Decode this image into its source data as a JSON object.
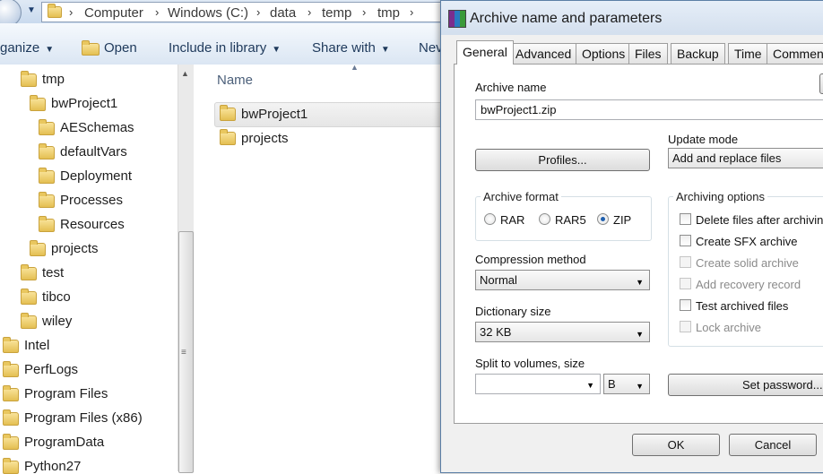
{
  "explorer": {
    "breadcrumbs": [
      "Computer",
      "Windows (C:)",
      "data",
      "temp",
      "tmp"
    ],
    "toolbar": {
      "organize": "ganize",
      "open": "Open",
      "include_in_library": "Include in library",
      "share_with": "Share with",
      "new": "Nev"
    },
    "tree": [
      {
        "label": "tmp",
        "level": 1
      },
      {
        "label": "bwProject1",
        "level": 2
      },
      {
        "label": "AESchemas",
        "level": 3
      },
      {
        "label": "defaultVars",
        "level": 3
      },
      {
        "label": "Deployment",
        "level": 3
      },
      {
        "label": "Processes",
        "level": 3
      },
      {
        "label": "Resources",
        "level": 3
      },
      {
        "label": "projects",
        "level": 2
      },
      {
        "label": "test",
        "level": 1
      },
      {
        "label": "tibco",
        "level": 1
      },
      {
        "label": "wiley",
        "level": 1
      },
      {
        "label": "Intel",
        "level": 0
      },
      {
        "label": "PerfLogs",
        "level": 0
      },
      {
        "label": "Program Files",
        "level": 0
      },
      {
        "label": "Program Files (x86)",
        "level": 0
      },
      {
        "label": "ProgramData",
        "level": 0
      },
      {
        "label": "Python27",
        "level": 0
      }
    ],
    "column_header": "Name",
    "files": [
      "bwProject1",
      "projects"
    ]
  },
  "dialog": {
    "title": "Archive name and parameters",
    "tabs": [
      "General",
      "Advanced",
      "Options",
      "Files",
      "Backup",
      "Time",
      "Comment"
    ],
    "active_tab": "General",
    "archive_name_label": "Archive name",
    "archive_name_value": "bwProject1.zip",
    "profiles_button": "Profiles...",
    "update_mode_label": "Update mode",
    "update_mode_value": "Add and replace files",
    "archive_format_label": "Archive format",
    "formats": [
      {
        "label": "RAR",
        "selected": false
      },
      {
        "label": "RAR5",
        "selected": false
      },
      {
        "label": "ZIP",
        "selected": true
      }
    ],
    "compression_label": "Compression method",
    "compression_value": "Normal",
    "dictionary_label": "Dictionary size",
    "dictionary_value": "32 KB",
    "split_label": "Split to volumes, size",
    "split_value": "",
    "split_unit": "B",
    "archiving_options_label": "Archiving options",
    "options": [
      {
        "label": "Delete files after archiving",
        "enabled": true,
        "checked": false
      },
      {
        "label": "Create SFX archive",
        "enabled": true,
        "checked": false
      },
      {
        "label": "Create solid archive",
        "enabled": false,
        "checked": false
      },
      {
        "label": "Add recovery record",
        "enabled": false,
        "checked": false
      },
      {
        "label": "Test archived files",
        "enabled": true,
        "checked": false
      },
      {
        "label": "Lock archive",
        "enabled": false,
        "checked": false
      }
    ],
    "set_password_button": "Set password...",
    "ok_button": "OK",
    "cancel_button": "Cancel"
  }
}
